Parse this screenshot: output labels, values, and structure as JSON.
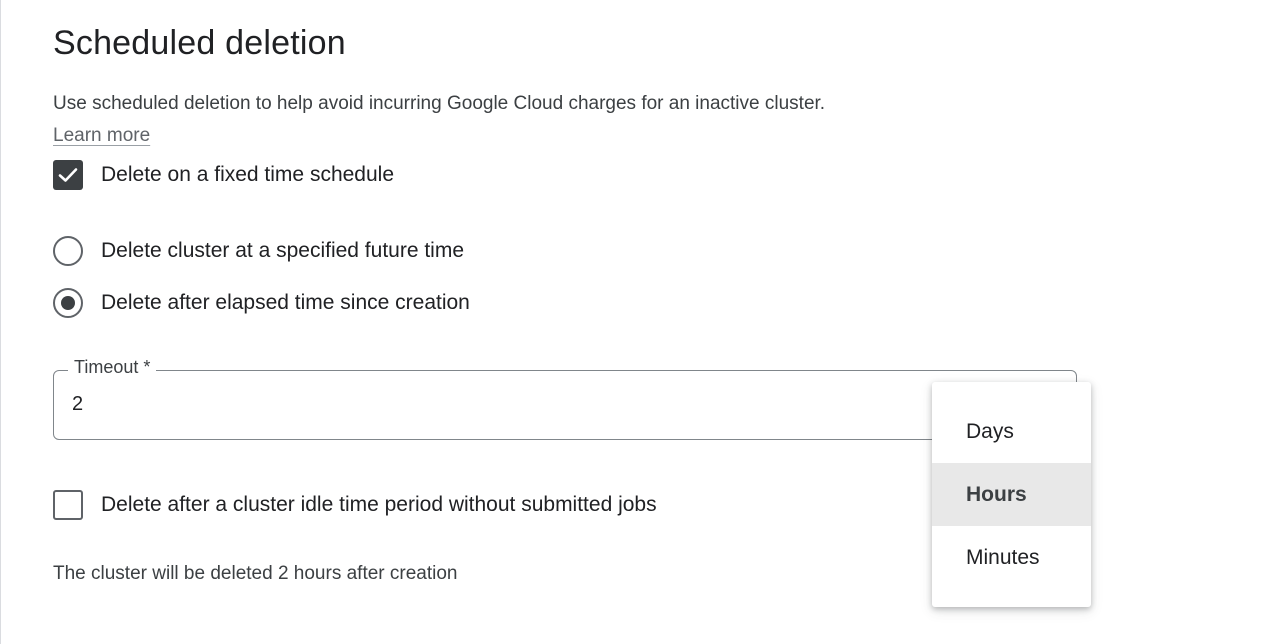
{
  "section": {
    "title": "Scheduled deletion",
    "description": "Use scheduled deletion to help avoid incurring Google Cloud charges for an inactive cluster.",
    "learn_more": "Learn more"
  },
  "fixed_schedule": {
    "label": "Delete on a fixed time schedule",
    "checked": true
  },
  "schedule_options": [
    {
      "label": "Delete cluster at a specified future time",
      "selected": false
    },
    {
      "label": "Delete after elapsed time since creation",
      "selected": true
    }
  ],
  "timeout": {
    "label": "Timeout *",
    "value": "2"
  },
  "idle_deletion": {
    "label": "Delete after a cluster idle time period without submitted jobs",
    "checked": false
  },
  "summary": "The cluster will be deleted 2 hours after creation",
  "unit_menu": {
    "options": [
      "Days",
      "Hours",
      "Minutes"
    ],
    "selected": "Hours"
  },
  "colors": {
    "checkbox_checked": "#3c4043",
    "text_primary": "#202124",
    "text_secondary": "#3c4043",
    "menu_selected_bg": "#e8e8e8"
  }
}
